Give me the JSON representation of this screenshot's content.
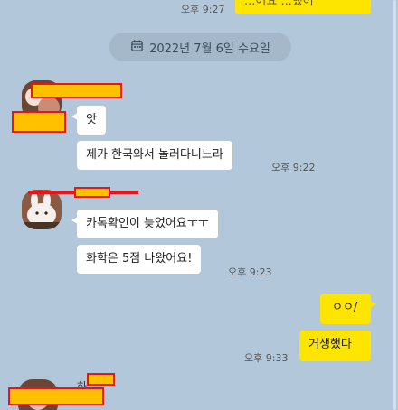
{
  "chat": {
    "top_out_message": {
      "text": "...어요 ...했어",
      "time": "오후 9:27"
    },
    "date_divider": {
      "label": "2022년 7월 6일 수요일"
    },
    "group1": {
      "messages": [
        {
          "text": "앗"
        },
        {
          "text": "제가 한국와서 놀러다니느라"
        }
      ],
      "time": "오후 9:22"
    },
    "group2": {
      "messages": [
        {
          "text": "카톡확인이 늦었어요ㅜㅜ"
        },
        {
          "text": "화학은 5점 나왔어요!"
        }
      ],
      "time": "오후 9:23"
    },
    "outgoing": {
      "messages": [
        {
          "text": "ㅇㅇ/"
        },
        {
          "text": "거생했다"
        }
      ],
      "time": "오후 9:33"
    },
    "group3": {
      "sender_partial": "하"
    }
  },
  "colors": {
    "background": "#b2c7da",
    "incoming_bubble": "#ffffff",
    "outgoing_bubble": "#fee500",
    "redaction_fill": "#ffc000",
    "redaction_border": "#e8161b"
  },
  "icons": {
    "date": "calendar-icon"
  }
}
